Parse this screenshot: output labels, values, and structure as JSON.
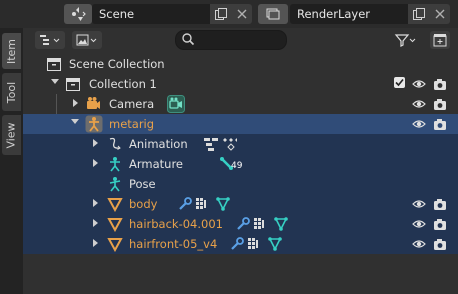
{
  "header": {
    "scene_label": "Scene",
    "viewlayer_label": "RenderLayer"
  },
  "side_tabs": [
    "Item",
    "Tool",
    "View"
  ],
  "toolbar": {
    "search": {
      "value": "",
      "placeholder": ""
    }
  },
  "tree": {
    "scene_collection": "Scene Collection",
    "collection_1": "Collection 1",
    "camera": "Camera",
    "metarig": "metarig",
    "animation": "Animation",
    "armature": "Armature",
    "armature_badge": "49",
    "pose": "Pose",
    "body": "body",
    "hairback": "hairback-04.001",
    "hairfront": "hairfront-05_v4"
  },
  "colors": {
    "selected_row": "#304c78",
    "selected_bg": "#223452",
    "object_orange": "#e8a14a",
    "modifier_blue": "#5aa0e6",
    "mesh_teal": "#36d0c4"
  }
}
